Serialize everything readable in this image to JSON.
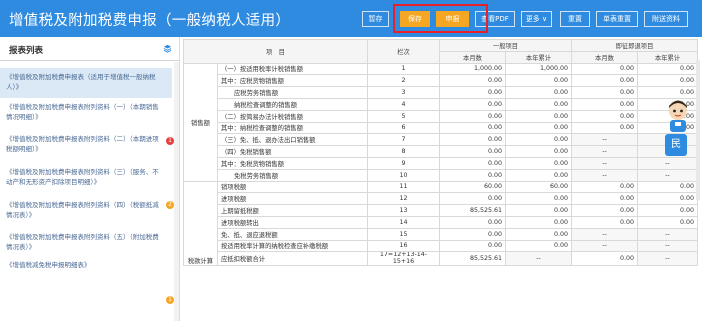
{
  "header": {
    "title": "增值税及附加税费申报（一般纳税人适用）",
    "buttons": {
      "save": "暂存",
      "preview": "保存",
      "submit": "申报",
      "view_pdf": "查看PDF",
      "more": "更多",
      "reset": "重置",
      "single_reset": "单表重置",
      "attachments": "附送资料"
    }
  },
  "sidebar": {
    "title": "报表列表",
    "items": [
      {
        "label": "《增值税及附加税费申报表（适用于增值税一般纳税人）》",
        "badge": ""
      },
      {
        "label": "《增值税及附加税费申报表附列资料（一）（本期销售情况明细）》",
        "badge": "1"
      },
      {
        "label": "《增值税及附加税费申报表附列资料（二）（本期进项税额明细）》",
        "badge": ""
      },
      {
        "label": "《增值税及附加税费申报表附列资料（三）（服务、不动产和无形资产扣除项目明细）》",
        "badge": "2"
      },
      {
        "label": "《增值税及附加税费申报表附列资料（四）（税额抵减情况表）》",
        "badge": ""
      },
      {
        "label": "《增值税及附加税费申报表附列资料（五）（附加税费情况表）》",
        "badge": ""
      },
      {
        "label": "《增值税减免税申报明细表》",
        "badge": "1"
      }
    ]
  },
  "table": {
    "headers": {
      "item": "项　目",
      "line": "栏次",
      "general": "一般项目",
      "refund": "即征即退项目",
      "current": "本月数",
      "cumulative": "本年累计"
    },
    "categories": {
      "sales": "销售额",
      "tax": "税款计算"
    },
    "rows": [
      {
        "item": "（一）按适用税率计税销售额",
        "line": "1",
        "g_cur": "1,000.00",
        "g_cum": "1,000.00",
        "r_cur": "0.00",
        "r_cum": "0.00"
      },
      {
        "item": "其中：应税货物销售额",
        "line": "2",
        "g_cur": "0.00",
        "g_cum": "0.00",
        "r_cur": "0.00",
        "r_cum": "0.00"
      },
      {
        "item": "应税劳务销售额",
        "line": "3",
        "g_cur": "0.00",
        "g_cum": "0.00",
        "r_cur": "0.00",
        "r_cum": "0.00"
      },
      {
        "item": "纳税检查调整的销售额",
        "line": "4",
        "g_cur": "0.00",
        "g_cum": "0.00",
        "r_cur": "0.00",
        "r_cum": "0.00"
      },
      {
        "item": "（二）按简易办法计税销售额",
        "line": "5",
        "g_cur": "0.00",
        "g_cum": "0.00",
        "r_cur": "0.00",
        "r_cum": "0.00"
      },
      {
        "item": "其中：纳税检查调整的销售额",
        "line": "6",
        "g_cur": "0.00",
        "g_cum": "0.00",
        "r_cur": "0.00",
        "r_cum": "0.00"
      },
      {
        "item": "（三）免、抵、退办法出口销售额",
        "line": "7",
        "g_cur": "0.00",
        "g_cum": "0.00",
        "r_cur": "--",
        "r_cum": "--"
      },
      {
        "item": "（四）免税销售额",
        "line": "8",
        "g_cur": "0.00",
        "g_cum": "0.00",
        "r_cur": "--",
        "r_cum": "--"
      },
      {
        "item": "其中：免税货物销售额",
        "line": "9",
        "g_cur": "0.00",
        "g_cum": "0.00",
        "r_cur": "--",
        "r_cum": "--"
      },
      {
        "item": "免税劳务销售额",
        "line": "10",
        "g_cur": "0.00",
        "g_cum": "0.00",
        "r_cur": "--",
        "r_cum": "--"
      },
      {
        "item": "销项税额",
        "line": "11",
        "g_cur": "60.00",
        "g_cum": "60.00",
        "r_cur": "0.00",
        "r_cum": "0.00"
      },
      {
        "item": "进项税额",
        "line": "12",
        "g_cur": "0.00",
        "g_cum": "0.00",
        "r_cur": "0.00",
        "r_cum": "0.00"
      },
      {
        "item": "上期留抵税额",
        "line": "13",
        "g_cur": "85,525.61",
        "g_cum": "0.00",
        "r_cur": "0.00",
        "r_cum": "0.00"
      },
      {
        "item": "进项税额转出",
        "line": "14",
        "g_cur": "0.00",
        "g_cum": "0.00",
        "r_cur": "0.00",
        "r_cum": "0.00"
      },
      {
        "item": "免、抵、退应退税额",
        "line": "15",
        "g_cur": "0.00",
        "g_cum": "0.00",
        "r_cur": "--",
        "r_cum": "--"
      },
      {
        "item": "按适用税率计算的纳税检查应补缴税额",
        "line": "16",
        "g_cur": "0.00",
        "g_cum": "0.00",
        "r_cur": "--",
        "r_cum": "--"
      },
      {
        "item": "应抵扣税额合计",
        "line": "17=12+13-14-15+16",
        "g_cur": "85,525.61",
        "g_cum": "--",
        "r_cur": "0.00",
        "r_cum": "--"
      }
    ]
  },
  "assistant": {
    "tab_label": "民"
  }
}
